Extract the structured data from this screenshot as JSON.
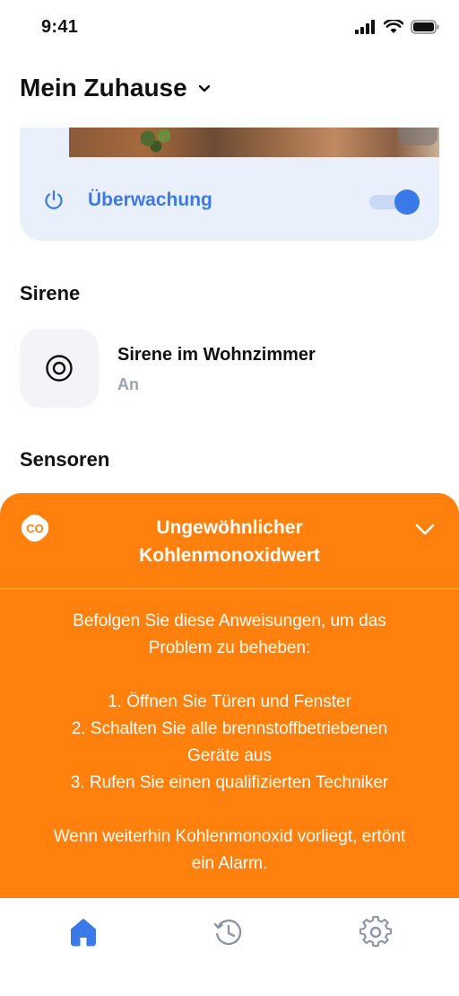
{
  "status_bar": {
    "time": "9:41"
  },
  "header": {
    "title": "Mein Zuhause"
  },
  "camera_card": {
    "label": "Überwachung",
    "monitoring_enabled": true
  },
  "sections": {
    "siren_title": "Sirene",
    "sensors_title": "Sensoren"
  },
  "siren": {
    "name": "Sirene im Wohnzimmer",
    "status": "An"
  },
  "alert": {
    "badge": "CO",
    "title_line1": "Ungewöhnlicher",
    "title_line2": "Kohlenmonoxidwert",
    "intro_line1": "Befolgen Sie diese Anweisungen, um das",
    "intro_line2": "Problem zu beheben:",
    "step1": "1. Öffnen Sie Türen und Fenster",
    "step2_line1": "2. Schalten Sie alle brennstoffbetriebenen",
    "step2_line2": "Geräte aus",
    "step3": "3. Rufen Sie einen qualifizierten Techniker",
    "footer_line1": "Wenn weiterhin Kohlenmonoxid vorliegt, ertönt",
    "footer_line2": "ein Alarm.",
    "accent_color": "#ff800d"
  },
  "tabbar": {
    "items": [
      {
        "icon": "home-icon",
        "active": true
      },
      {
        "icon": "history-icon",
        "active": false
      },
      {
        "icon": "settings-icon",
        "active": false
      }
    ],
    "active_color": "#3a7ae8",
    "inactive_color": "#8d95a6"
  }
}
